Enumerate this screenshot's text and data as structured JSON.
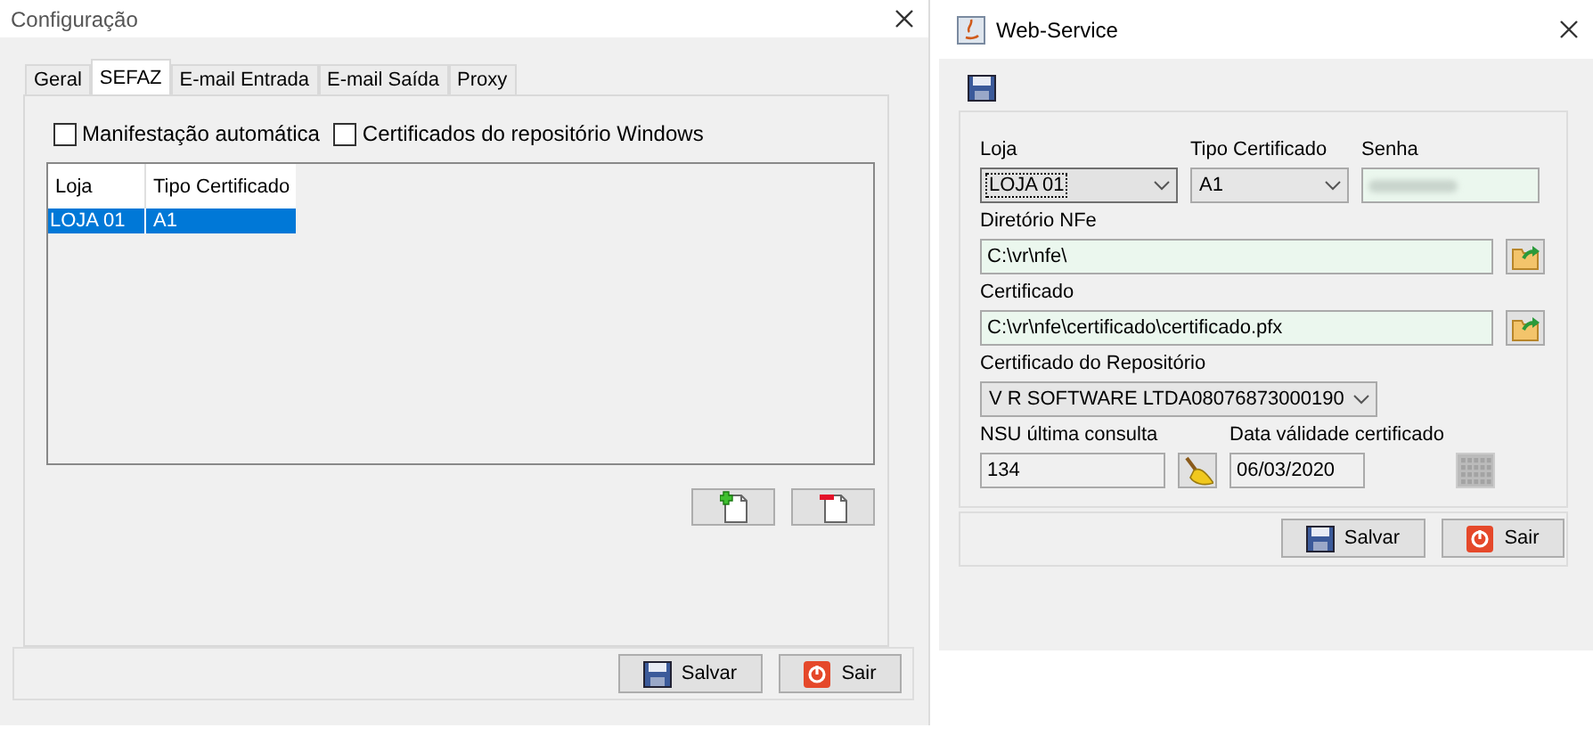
{
  "config_window": {
    "title": "Configuração",
    "tabs": [
      {
        "label": "Geral",
        "selected": false
      },
      {
        "label": "SEFAZ",
        "selected": true
      },
      {
        "label": "E-mail Entrada",
        "selected": false
      },
      {
        "label": "E-mail Saída",
        "selected": false
      },
      {
        "label": "Proxy",
        "selected": false
      }
    ],
    "checkboxes": [
      {
        "label": "Manifestação automática",
        "checked": false
      },
      {
        "label": "Certificados do repositório Windows",
        "checked": false
      }
    ],
    "table": {
      "columns": [
        "Loja",
        "Tipo Certificado"
      ],
      "rows": [
        {
          "cells": [
            "LOJA 01",
            "A1"
          ],
          "selected": true
        }
      ]
    },
    "buttons": [
      {
        "label": "Salvar",
        "kind": "save"
      },
      {
        "label": "Sair",
        "kind": "exit"
      }
    ]
  },
  "webservice_window": {
    "title": "Web-Service",
    "fields": [
      {
        "label": "Loja",
        "kind": "combo",
        "value": "LOJA 01",
        "focused": true
      },
      {
        "label": "Tipo Certificado",
        "kind": "combo",
        "value": "A1",
        "focused": false
      },
      {
        "label": "Senha",
        "kind": "password"
      },
      {
        "label": "Diretório NFe",
        "kind": "path",
        "value": "C:\\vr\\nfe\\"
      },
      {
        "label": "Certificado",
        "kind": "path",
        "value": "C:\\vr\\nfe\\certificado\\certificado.pfx"
      },
      {
        "label": "Certificado do Repositório",
        "kind": "combo",
        "value": "V R SOFTWARE LTDA08076873000190",
        "focused": false
      },
      {
        "label": "NSU última consulta",
        "kind": "nsu",
        "value": "134"
      },
      {
        "label": "Data válidade certificado",
        "kind": "date",
        "value": "06/03/2020"
      }
    ],
    "buttons": [
      {
        "label": "Salvar",
        "kind": "save"
      },
      {
        "label": "Sair",
        "kind": "exit"
      }
    ]
  }
}
